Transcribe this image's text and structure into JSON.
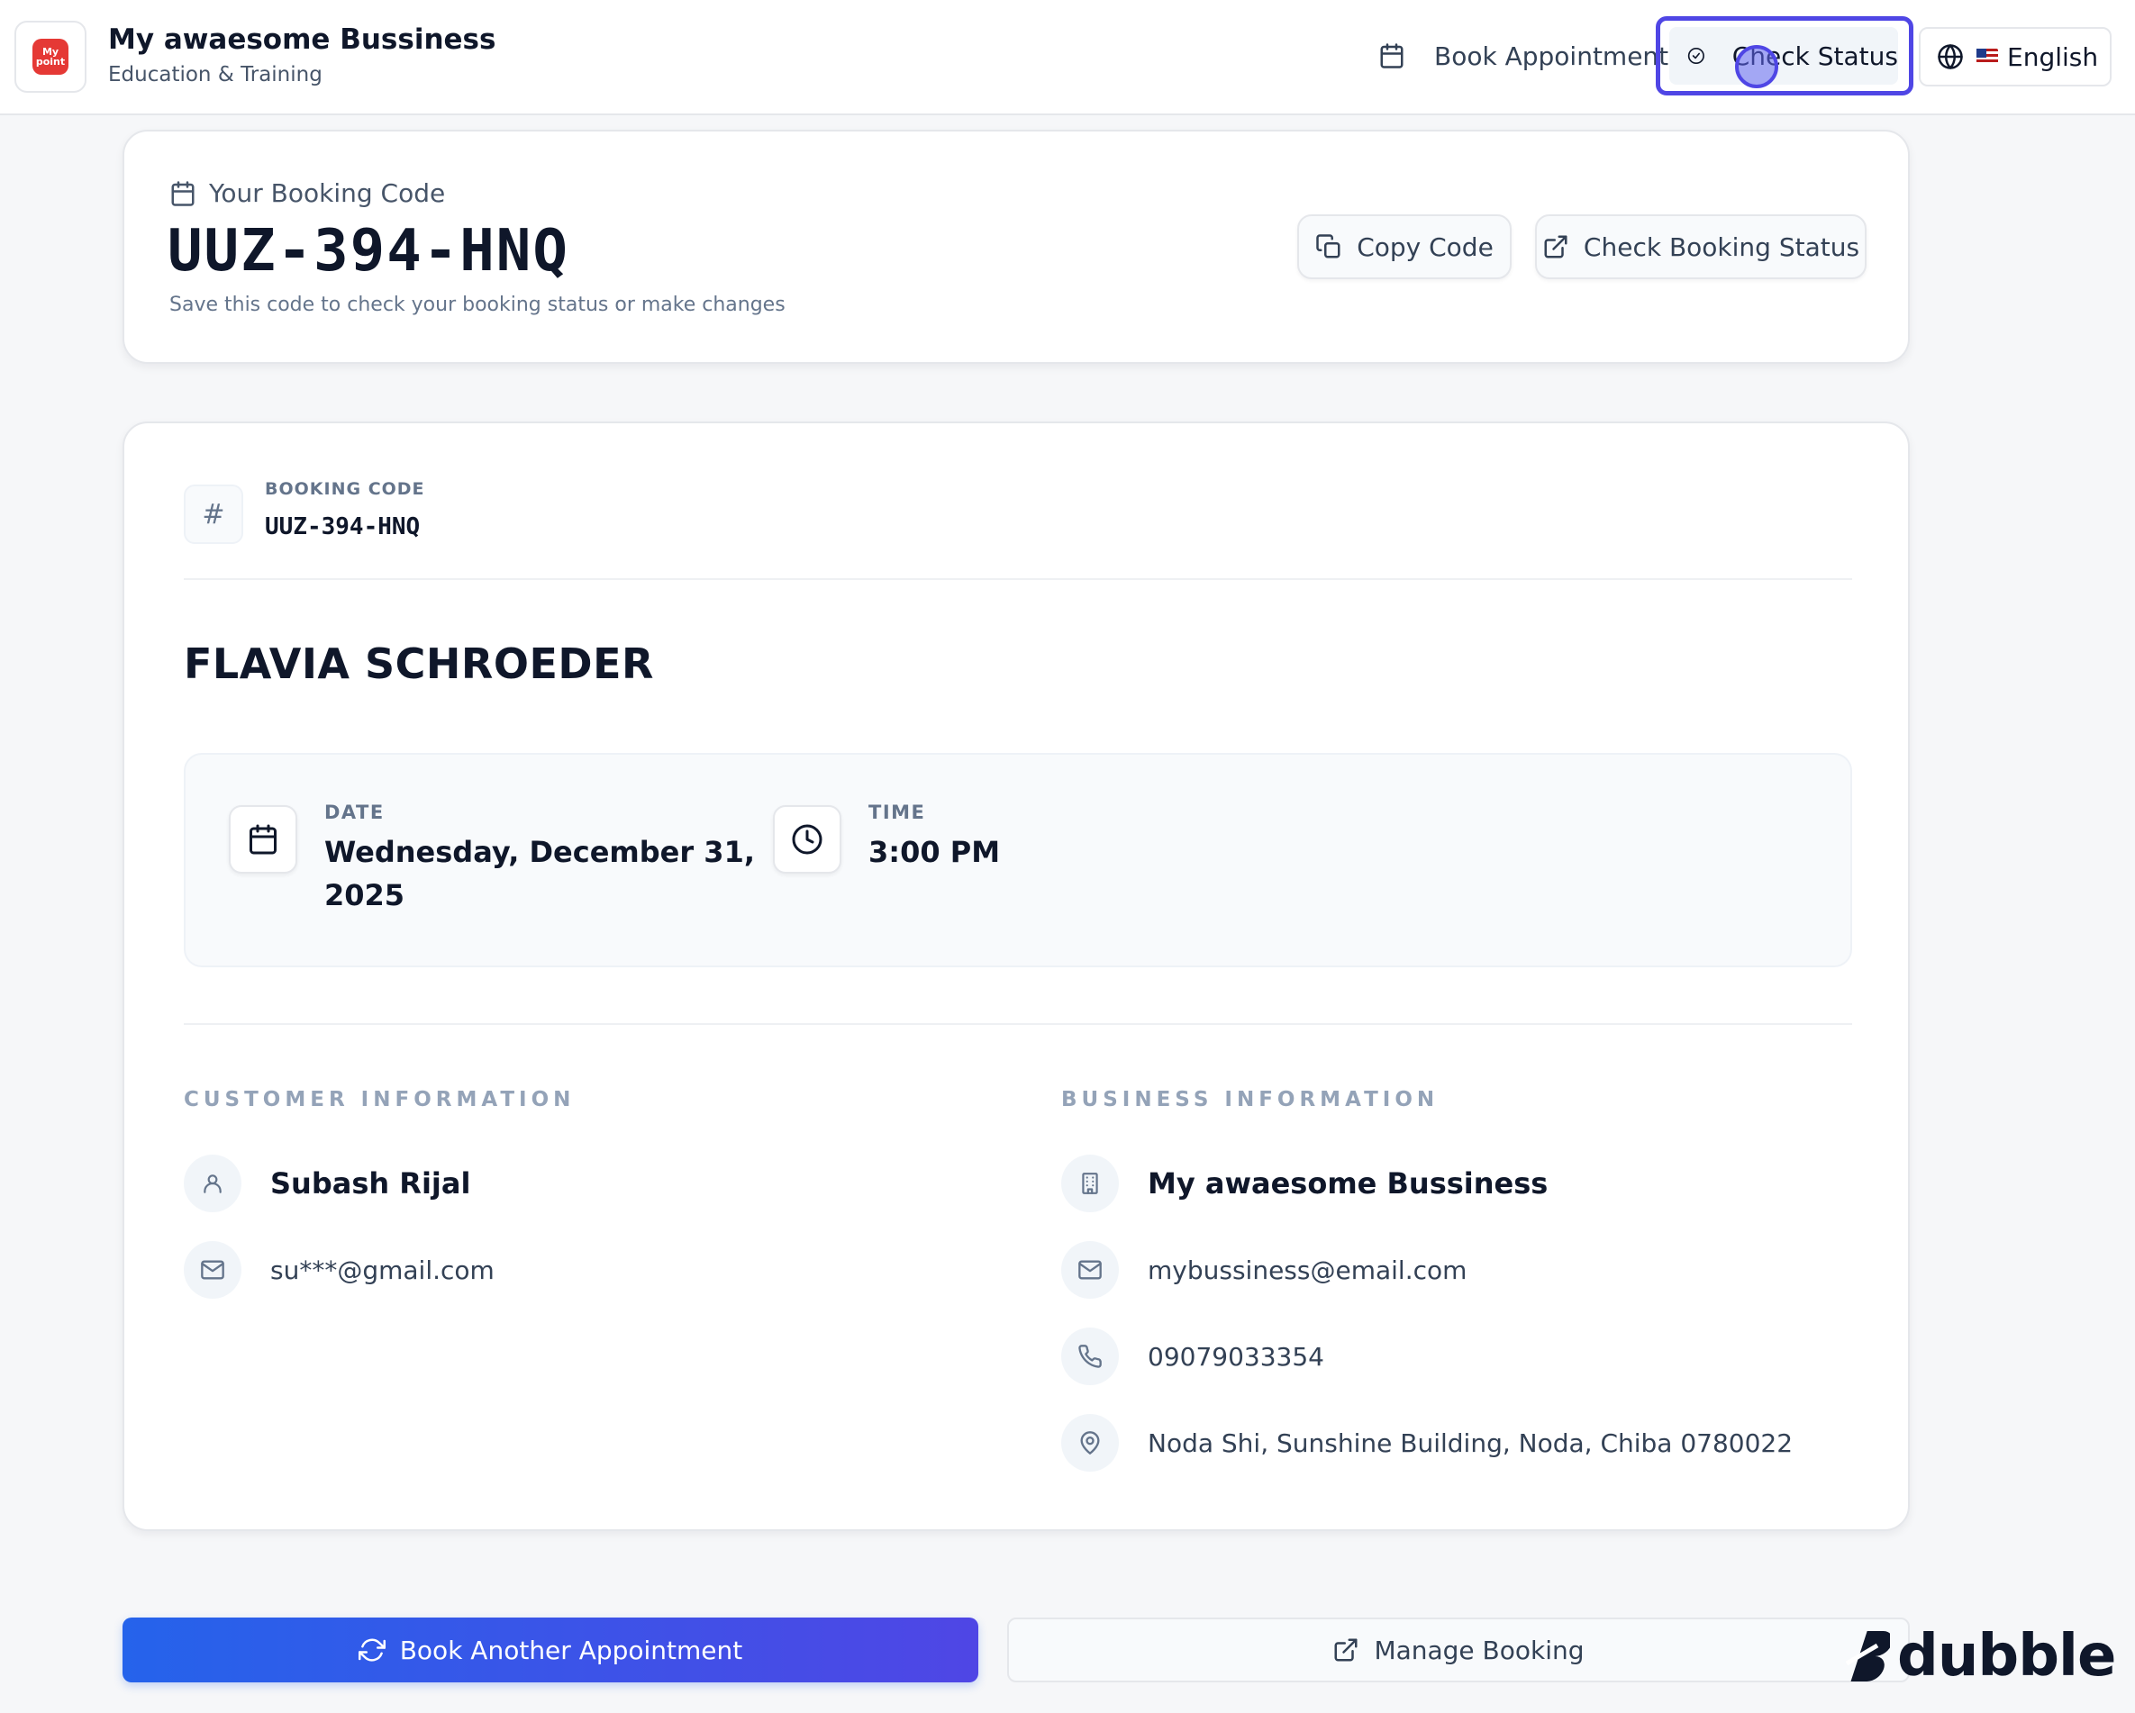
{
  "header": {
    "business_name": "My awaesome Bussiness",
    "business_category": "Education & Training",
    "logo_text_line1": "My",
    "logo_text_line2": "point",
    "nav": {
      "book_label": "Book Appointment",
      "check_label": "Check Status",
      "language_label": "English"
    }
  },
  "code_card": {
    "label": "Your Booking Code",
    "code": "UUZ-394-HNQ",
    "hint": "Save this code to check your booking status or make changes",
    "copy_label": "Copy Code",
    "check_label": "Check Booking Status"
  },
  "details": {
    "booking_code_label": "BOOKING CODE",
    "booking_code": "UUZ-394-HNQ",
    "service_name": "FLAVIA SCHROEDER",
    "date_label": "DATE",
    "date_line1": "Wednesday, December 31,",
    "date_line2": "2025",
    "time_label": "TIME",
    "time_value": "3:00 PM"
  },
  "customer": {
    "title": "CUSTOMER INFORMATION",
    "name": "Subash Rijal",
    "email": "su***@gmail.com"
  },
  "business": {
    "title": "BUSINESS INFORMATION",
    "name": "My awaesome Bussiness",
    "email": "mybussiness@email.com",
    "phone": "09079033354",
    "address": "Noda Shi, Sunshine Building, Noda, Chiba 0780022"
  },
  "actions": {
    "book_another": "Book Another Appointment",
    "manage": "Manage Booking"
  },
  "watermark": "dubble",
  "colors": {
    "accent": "#4f46e5",
    "primary_start": "#2563eb",
    "logo_red": "#e53935"
  }
}
